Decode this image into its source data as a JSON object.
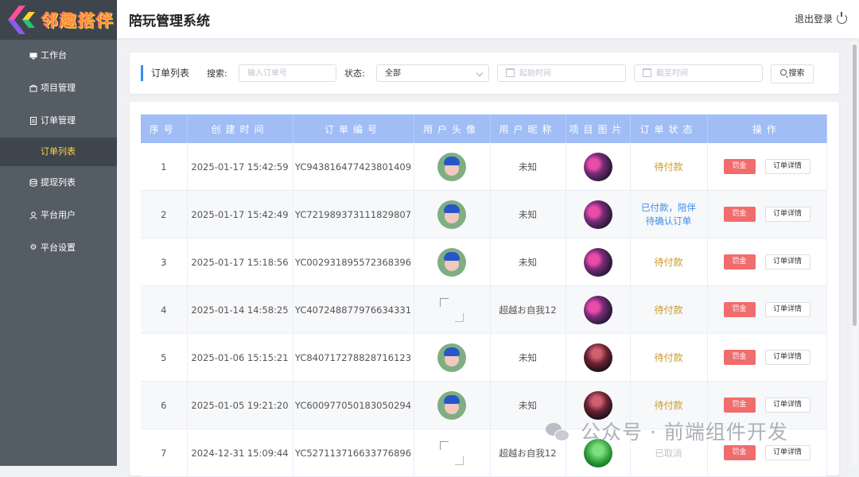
{
  "app": {
    "logo_text": "邻趣搭伴",
    "title": "陪玩管理系统",
    "logout": "退出登录"
  },
  "sidebar": {
    "items": [
      {
        "label": "工作台",
        "icon": "monitor-icon"
      },
      {
        "label": "项目管理",
        "icon": "package-icon"
      },
      {
        "label": "订单管理",
        "icon": "document-icon"
      },
      {
        "label": "订单列表",
        "icon": "",
        "active": true
      },
      {
        "label": "提现列表",
        "icon": "database-icon"
      },
      {
        "label": "平台用户",
        "icon": "user-icon"
      },
      {
        "label": "平台设置",
        "icon": "gear-icon"
      }
    ]
  },
  "filter": {
    "title": "订单列表",
    "search_label": "搜索:",
    "search_placeholder": "输入订单号",
    "status_label": "状态:",
    "status_value": "全部",
    "start_placeholder": "起始时间",
    "end_placeholder": "截至时间",
    "search_button": "搜索"
  },
  "table": {
    "headers": [
      "序号",
      "创建时间",
      "订单编号",
      "用户头像",
      "用户昵称",
      "项目图片",
      "订单状态",
      "操作"
    ],
    "fine_label": "罚金",
    "detail_label": "订单详情",
    "rows": [
      {
        "index": "1",
        "created": "2025-01-17 15:42:59",
        "order_no": "YC943816477423801409",
        "avatar": "cartoon",
        "nickname": "未知",
        "project": "game",
        "status": "待付款",
        "status_type": "pending"
      },
      {
        "index": "2",
        "created": "2025-01-17 15:42:49",
        "order_no": "YC721989373111829807",
        "avatar": "cartoon",
        "nickname": "未知",
        "project": "game",
        "status": "已付款，陪伴待确认订单",
        "status_type": "paid"
      },
      {
        "index": "3",
        "created": "2025-01-17 15:18:56",
        "order_no": "YC002931895572368396",
        "avatar": "cartoon",
        "nickname": "未知",
        "project": "game",
        "status": "待付款",
        "status_type": "pending"
      },
      {
        "index": "4",
        "created": "2025-01-14 14:58:25",
        "order_no": "YC407248877976634331",
        "avatar": "broken",
        "nickname": "超越お自我12",
        "project": "game",
        "status": "待付款",
        "status_type": "pending"
      },
      {
        "index": "5",
        "created": "2025-01-06 15:15:21",
        "order_no": "YC840717278828716123",
        "avatar": "cartoon",
        "nickname": "未知",
        "project": "dark",
        "status": "待付款",
        "status_type": "pending"
      },
      {
        "index": "6",
        "created": "2025-01-05 19:21:20",
        "order_no": "YC600977050183050294",
        "avatar": "cartoon",
        "nickname": "未知",
        "project": "dark",
        "status": "待付款",
        "status_type": "pending"
      },
      {
        "index": "7",
        "created": "2024-12-31 15:09:44",
        "order_no": "YC527113716633776896",
        "avatar": "broken",
        "nickname": "超越お自我12",
        "project": "green",
        "status": "已取消",
        "status_type": "cancel"
      }
    ]
  },
  "watermark": {
    "text": "公众号 · 前端组件开发"
  },
  "colors": {
    "sidebar": "#545c64",
    "active_text": "#ffd04b",
    "header_row": "#a0bdf5",
    "fine_button": "#f16c6c",
    "pending": "#c99a2a",
    "paid": "#3a8ee6"
  }
}
